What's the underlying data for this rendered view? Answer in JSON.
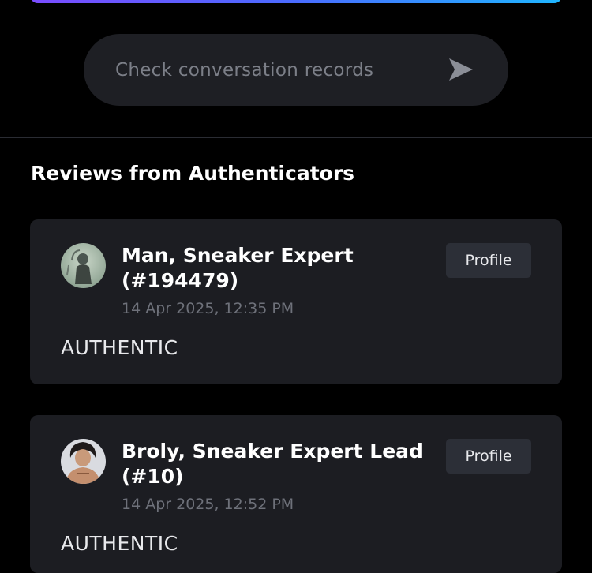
{
  "conversation": {
    "label": "Check conversation records",
    "icon": "send-icon"
  },
  "section": {
    "title": "Reviews from Authenticators"
  },
  "reviews": [
    {
      "name": "Man, Sneaker Expert (#194479)",
      "time": "14 Apr 2025, 12:35 PM",
      "verdict": "AUTHENTIC",
      "profile_label": "Profile"
    },
    {
      "name": "Broly, Sneaker Expert Lead (#10)",
      "time": "14 Apr 2025, 12:52 PM",
      "verdict": "AUTHENTIC",
      "profile_label": "Profile"
    }
  ],
  "colors": {
    "background": "#000000",
    "card": "#1c1d22",
    "accent_gradient_start": "#7b4dff",
    "accent_gradient_end": "#1fb6ff",
    "muted_text": "#6e717a"
  }
}
